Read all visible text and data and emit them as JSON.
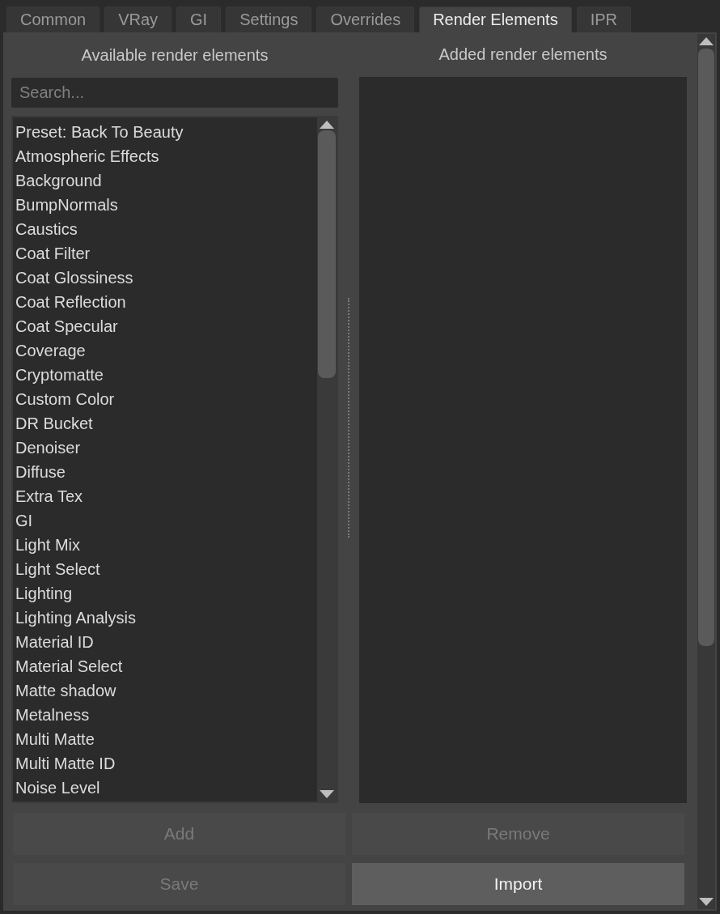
{
  "tabs": [
    {
      "label": "Common",
      "selected": false
    },
    {
      "label": "VRay",
      "selected": false
    },
    {
      "label": "GI",
      "selected": false
    },
    {
      "label": "Settings",
      "selected": false
    },
    {
      "label": "Overrides",
      "selected": false
    },
    {
      "label": "Render Elements",
      "selected": true
    },
    {
      "label": "IPR",
      "selected": false
    }
  ],
  "available": {
    "title": "Available render elements",
    "search": {
      "placeholder": "Search..."
    },
    "items": [
      "Preset: Back To Beauty",
      "Atmospheric Effects",
      "Background",
      "BumpNormals",
      "Caustics",
      "Coat Filter",
      "Coat Glossiness",
      "Coat Reflection",
      "Coat Specular",
      "Coverage",
      "Cryptomatte",
      "Custom Color",
      "DR Bucket",
      "Denoiser",
      "Diffuse",
      "Extra Tex",
      "GI",
      "Light Mix",
      "Light Select",
      "Lighting",
      "Lighting Analysis",
      "Material ID",
      "Material Select",
      "Matte shadow",
      "Metalness",
      "Multi Matte",
      "Multi Matte ID",
      "Noise Level"
    ]
  },
  "added": {
    "title": "Added render elements"
  },
  "buttons": [
    {
      "label": "Add",
      "disabled": true
    },
    {
      "label": "Remove",
      "disabled": true
    },
    {
      "label": "Save",
      "disabled": true
    },
    {
      "label": "Import",
      "disabled": false
    }
  ]
}
